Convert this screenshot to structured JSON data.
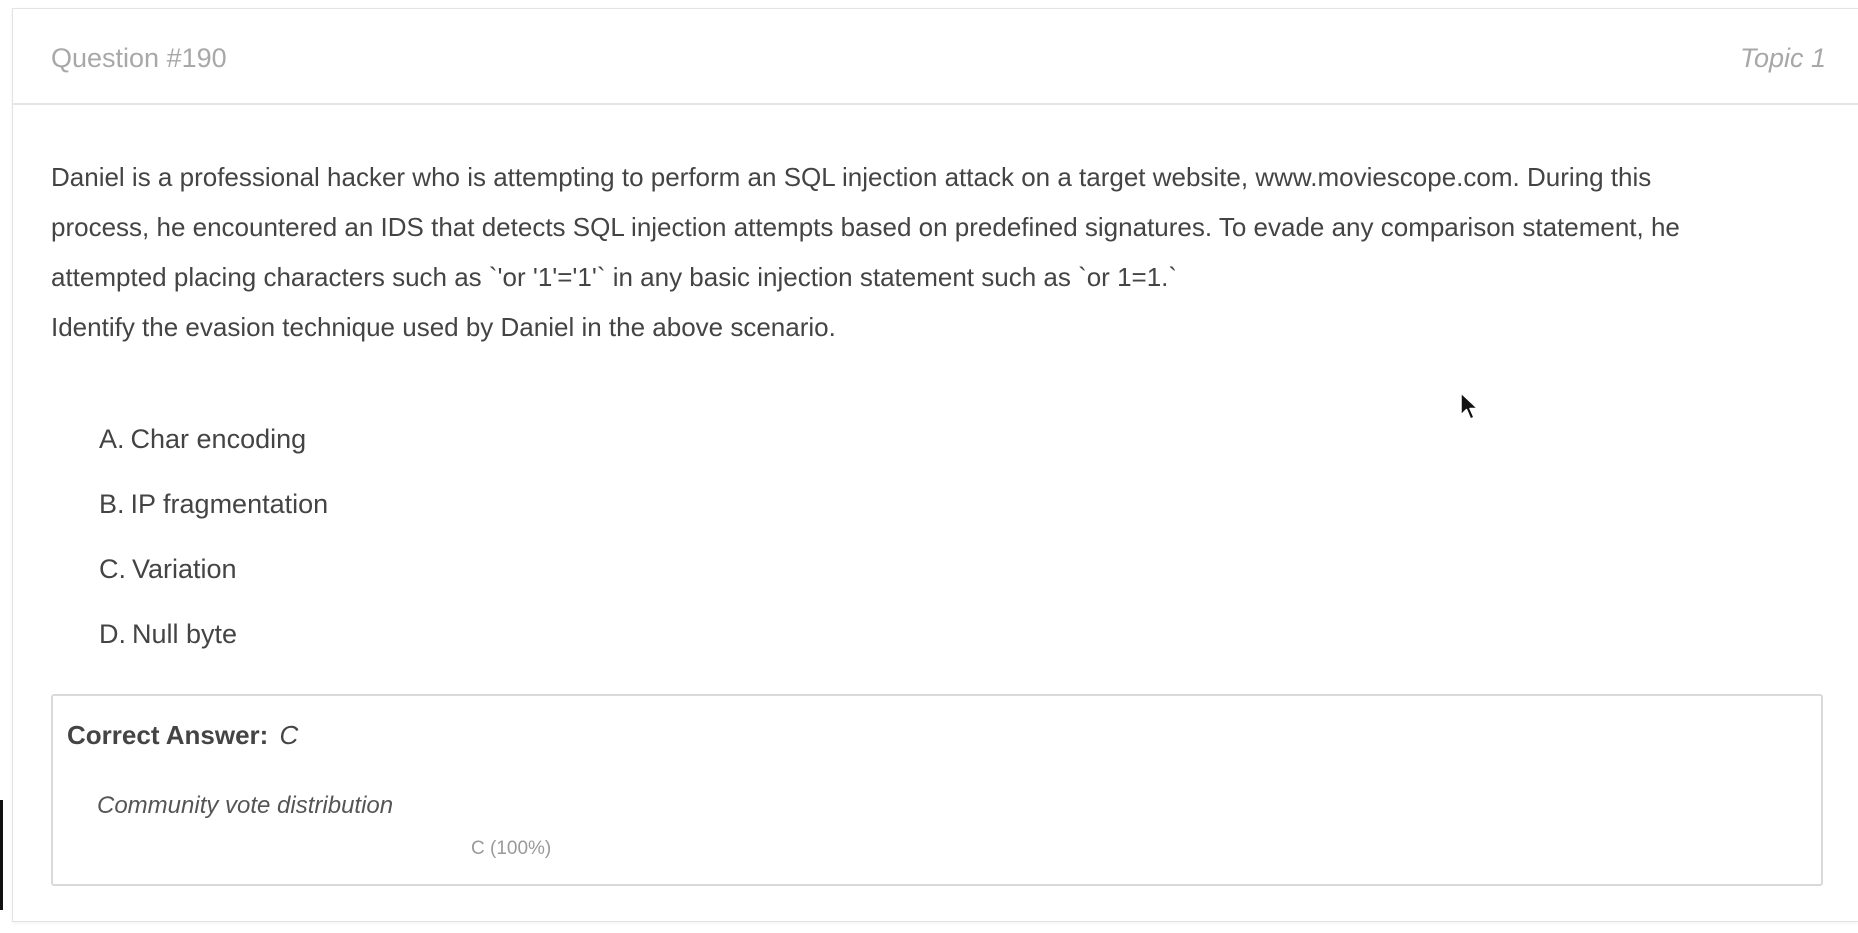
{
  "header": {
    "question_number": "Question #190",
    "topic": "Topic 1"
  },
  "question": {
    "lines": [
      "Daniel is a professional hacker who is attempting to perform an SQL injection attack on a target website, www.moviescope.com. During this",
      "process, he encountered an IDS that detects SQL injection attempts based on predefined signatures. To evade any comparison statement, he",
      "attempted placing characters such as `'or '1'='1'` in any basic injection statement such as `or 1=1.`",
      "Identify the evasion technique used by Daniel in the above scenario."
    ]
  },
  "choices": [
    {
      "letter": "A.",
      "text": "Char encoding"
    },
    {
      "letter": "B.",
      "text": "IP fragmentation"
    },
    {
      "letter": "C.",
      "text": "Variation"
    },
    {
      "letter": "D.",
      "text": "Null byte"
    }
  ],
  "answer": {
    "label": "Correct Answer:",
    "value": "C",
    "vote_title": "Community vote distribution",
    "vote_bar_label": "C (100%)"
  },
  "icons": {
    "cursor": "mouse-pointer-icon"
  },
  "colors": {
    "text": "#444444",
    "muted": "#a8a8a8",
    "border": "#d9d9d9"
  }
}
